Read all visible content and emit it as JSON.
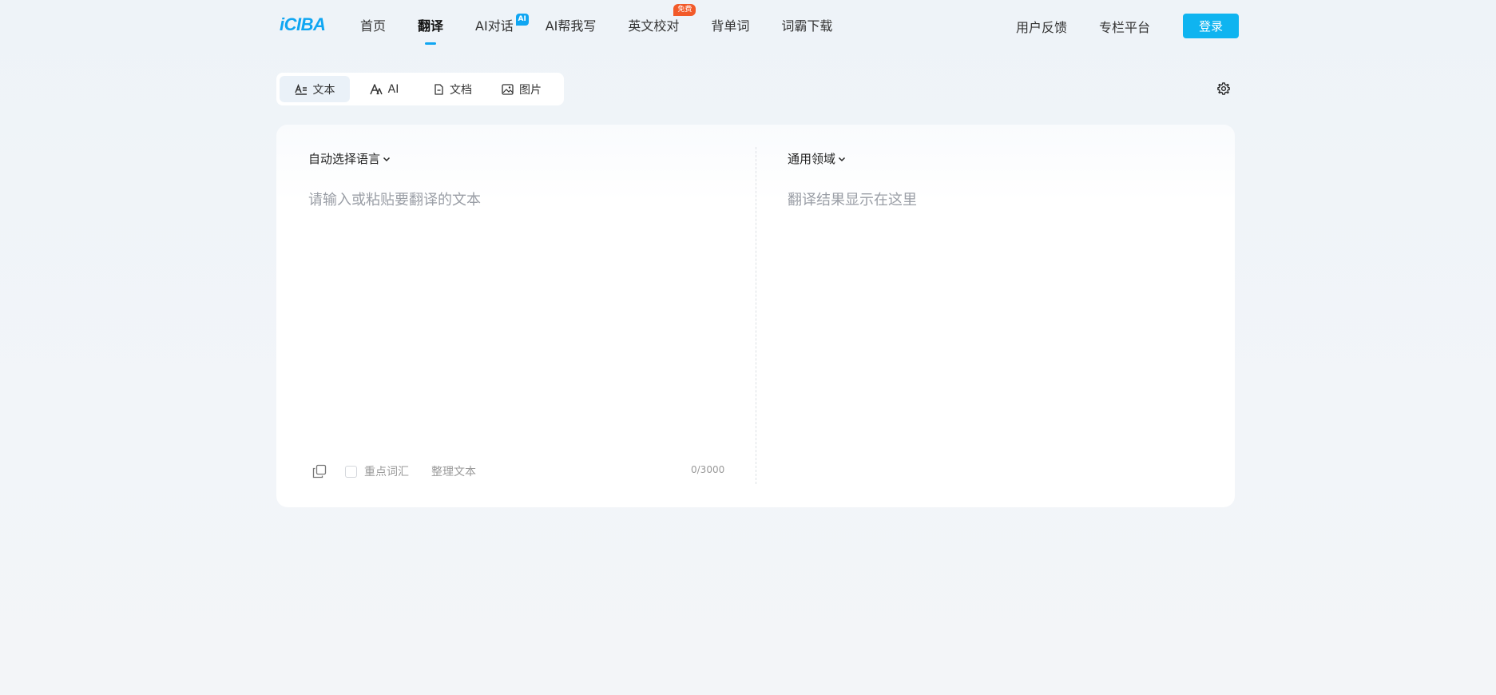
{
  "brand": {
    "logo": "iCIBA",
    "accent": "#10a6f2"
  },
  "nav": {
    "items": [
      {
        "label": "首页",
        "active": false
      },
      {
        "label": "翻译",
        "active": true
      },
      {
        "label": "AI对话",
        "badge": "AI"
      },
      {
        "label": "AI帮我写"
      },
      {
        "label": "英文校对",
        "badge": "免费"
      },
      {
        "label": "背单词"
      },
      {
        "label": "词霸下载"
      }
    ],
    "right": [
      {
        "label": "用户反馈"
      },
      {
        "label": "专栏平台"
      }
    ],
    "login_label": "登录",
    "login_color": "#0fb4f0"
  },
  "modes": [
    {
      "label": "文本",
      "icon": "text-mode-icon",
      "active": true
    },
    {
      "label": "AI",
      "icon": "ai-mode-icon"
    },
    {
      "label": "文档",
      "icon": "document-icon"
    },
    {
      "label": "图片",
      "icon": "image-icon"
    }
  ],
  "translator": {
    "source_lang": "自动选择语言",
    "target_domain": "通用领域",
    "input_placeholder": "请输入或粘贴要翻译的文本",
    "input_value": "",
    "output_placeholder": "翻译结果显示在这里",
    "key_vocab_label": "重点词汇",
    "key_vocab_checked": false,
    "tidy_label": "整理文本",
    "char_count": "0/3000"
  }
}
